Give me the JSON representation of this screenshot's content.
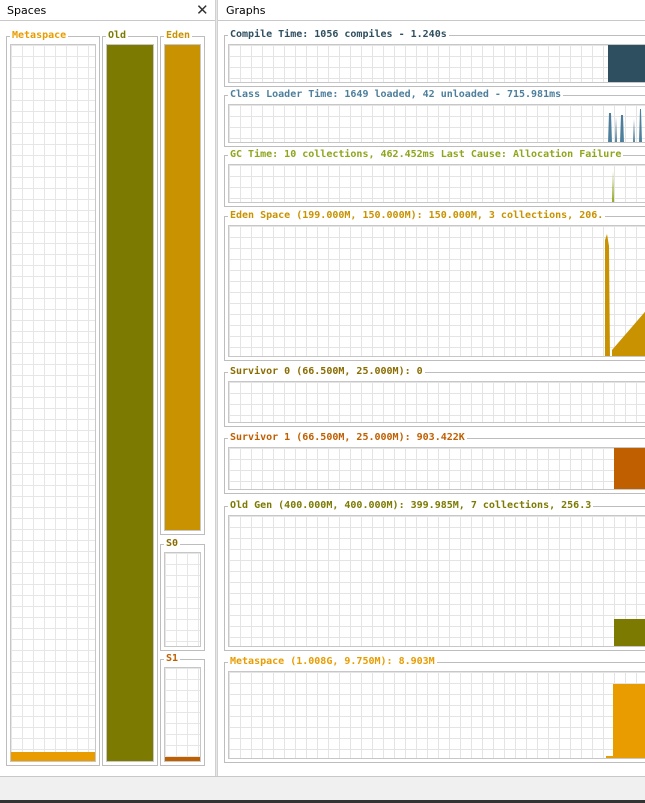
{
  "spaces": {
    "title": "Spaces",
    "close_symbol": "✕",
    "metaspace": {
      "label": "Metaspace",
      "fill_fraction": 0.012
    },
    "old": {
      "label": "Old",
      "fill_fraction": 1.0
    },
    "eden": {
      "label": "Eden",
      "fill_fraction": 1.0
    },
    "s0": {
      "label": "S0",
      "fill_fraction": 0.0
    },
    "s1": {
      "label": "S1",
      "fill_fraction": 0.04
    }
  },
  "graphs": {
    "title": "Graphs",
    "compile": {
      "title": "Compile Time: 1056 compiles - 1.240s",
      "color": "#2e4f5f"
    },
    "classloader": {
      "title": "Class Loader Time: 1649 loaded, 42 unloaded - 715.981ms",
      "color": "#4d7f9c"
    },
    "gc": {
      "title": "GC Time: 10 collections, 462.452ms Last Cause: Allocation Failure",
      "color": "#8fa51c"
    },
    "eden": {
      "title": "Eden Space (199.000M, 150.000M): 150.000M, 3 collections, 206.",
      "color": "#c89200"
    },
    "survivor0": {
      "title": "Survivor 0 (66.500M, 25.000M): 0",
      "color": "#8a6c00"
    },
    "survivor1": {
      "title": "Survivor 1 (66.500M, 25.000M): 903.422K",
      "color": "#c05f00"
    },
    "oldgen": {
      "title": "Old Gen (400.000M, 400.000M): 399.985M, 7 collections, 256.3",
      "color": "#7c7a00"
    },
    "metaspace": {
      "title": "Metaspace (1.008G, 9.750M): 8.903M",
      "color": "#e89c00"
    }
  },
  "colors": {
    "metaspace": "#e89c00",
    "old": "#7c7a00",
    "eden": "#c89200",
    "s0": "#8a6c00",
    "s1": "#c05f00"
  }
}
